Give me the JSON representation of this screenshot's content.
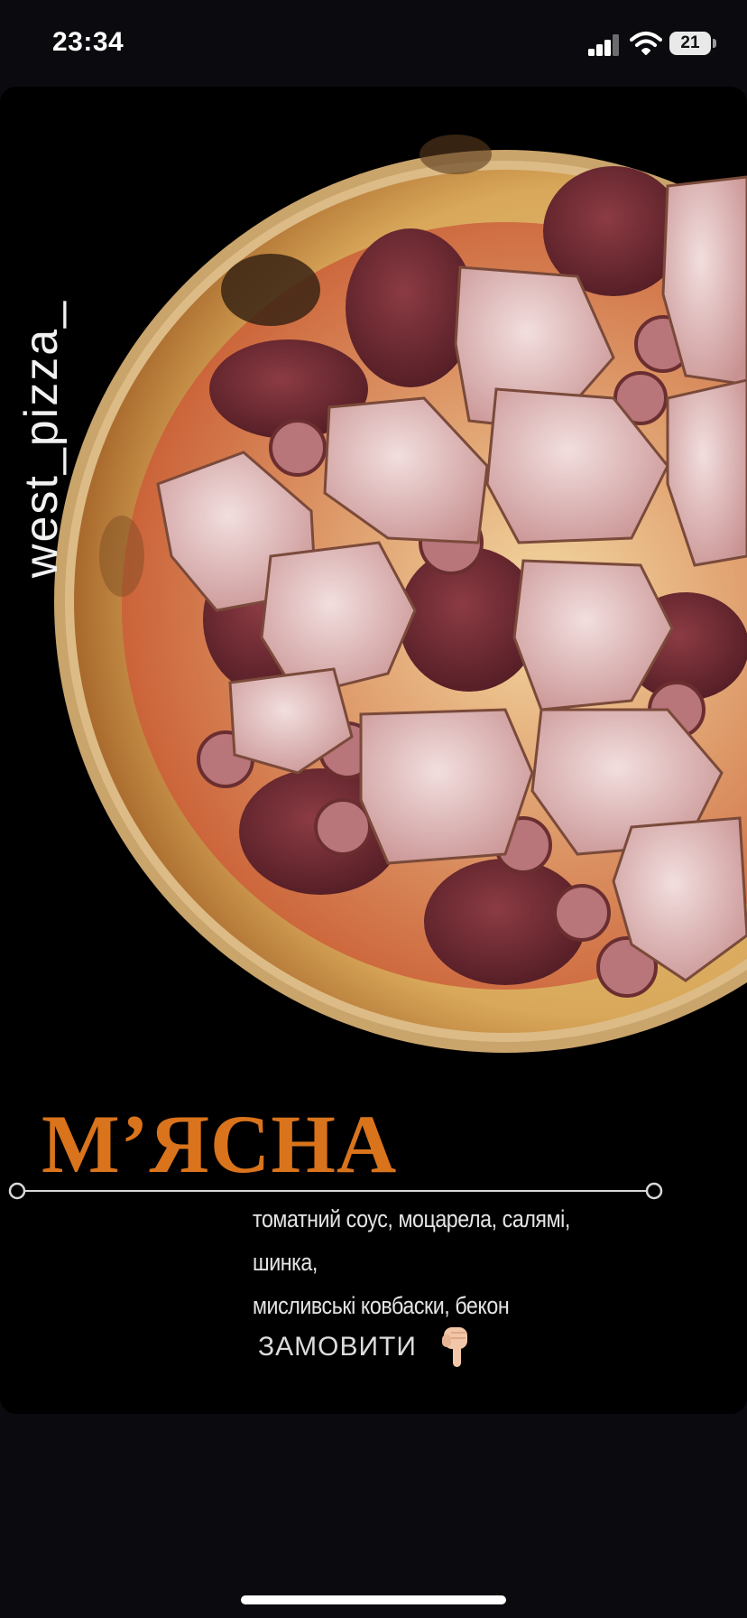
{
  "status_bar": {
    "time": "23:34",
    "battery": "21",
    "icons": [
      "signal-icon",
      "wifi-icon",
      "battery-icon"
    ]
  },
  "story": {
    "brand": "west_pizza_",
    "title": "М’ЯСНА",
    "ingredients_line1": "томатний соус, моцарела, салямі, шинка,",
    "ingredients_line2": "мисливські ковбаски, бекон",
    "order_label": "ЗАМОВИТИ",
    "order_icon": "pointing-down-hand-icon",
    "image": "meat-pizza-photo"
  },
  "colors": {
    "background": "#000000",
    "title_accent": "#d9731c",
    "text": "#e4e4e4"
  }
}
